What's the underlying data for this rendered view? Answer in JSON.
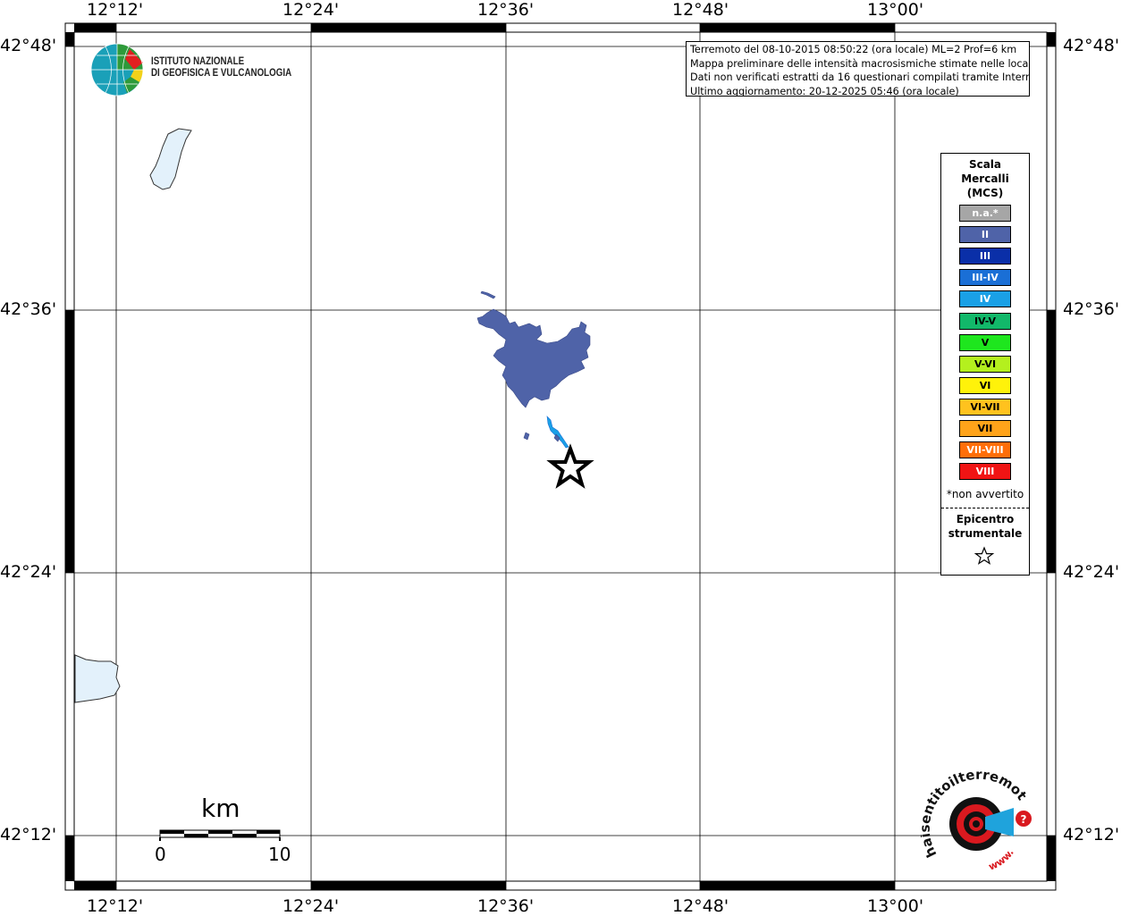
{
  "map": {
    "lon_ticks": [
      "12°12'",
      "12°24'",
      "12°36'",
      "12°48'",
      "13°00'"
    ],
    "lat_ticks": [
      "42°48'",
      "42°36'",
      "42°24'",
      "42°12'"
    ]
  },
  "info": {
    "line1": "Terremoto del 08-10-2015 08:50:22 (ora locale) ML=2 Prof=6 km",
    "line2": "Mappa preliminare delle intensità macrosismiche stimate nelle località",
    "line3": "Dati non verificati estratti da 16 questionari compilati tramite Internet.",
    "line4": "Ultimo aggiornamento: 20-12-2025 05:46 (ora locale)"
  },
  "logo": {
    "line1": "ISTITUTO NAZIONALE",
    "line2": "DI GEOFISICA E VULCANOLOGIA"
  },
  "legend": {
    "title1": "Scala",
    "title2": "Mercalli",
    "title3": "(MCS)",
    "classes": [
      {
        "label": "n.a.*",
        "color": "#a6a6a6"
      },
      {
        "label": "II",
        "color": "#4f63a8"
      },
      {
        "label": "III",
        "color": "#0a2fa8"
      },
      {
        "label": "III-IV",
        "color": "#1a6fd6"
      },
      {
        "label": "IV",
        "color": "#1aa0e6"
      },
      {
        "label": "IV-V",
        "color": "#12b86a"
      },
      {
        "label": "V",
        "color": "#1ee61e"
      },
      {
        "label": "V-VI",
        "color": "#b4f01e"
      },
      {
        "label": "VI",
        "color": "#fff20a"
      },
      {
        "label": "VI-VII",
        "color": "#ffc21e"
      },
      {
        "label": "VII",
        "color": "#ffa31a"
      },
      {
        "label": "VII-VIII",
        "color": "#ff6e0a"
      },
      {
        "label": "VIII",
        "color": "#f01414"
      }
    ],
    "note": "*non avvertito",
    "epicentro1": "Epicentro",
    "epicentro2": "strumentale"
  },
  "scalebar": {
    "unit": "km",
    "start": "0",
    "end": "10"
  },
  "haisentito": {
    "text": "haisentitoilterremoto.it",
    "www": "www.",
    "colors": {
      "red": "#d9191f",
      "blue": "#1fa3dc",
      "black": "#111111"
    }
  },
  "colors": {
    "intensity_II": "#4f63a8",
    "intensity_IV": "#1aa0e6",
    "lake": "#e3f1fb"
  }
}
